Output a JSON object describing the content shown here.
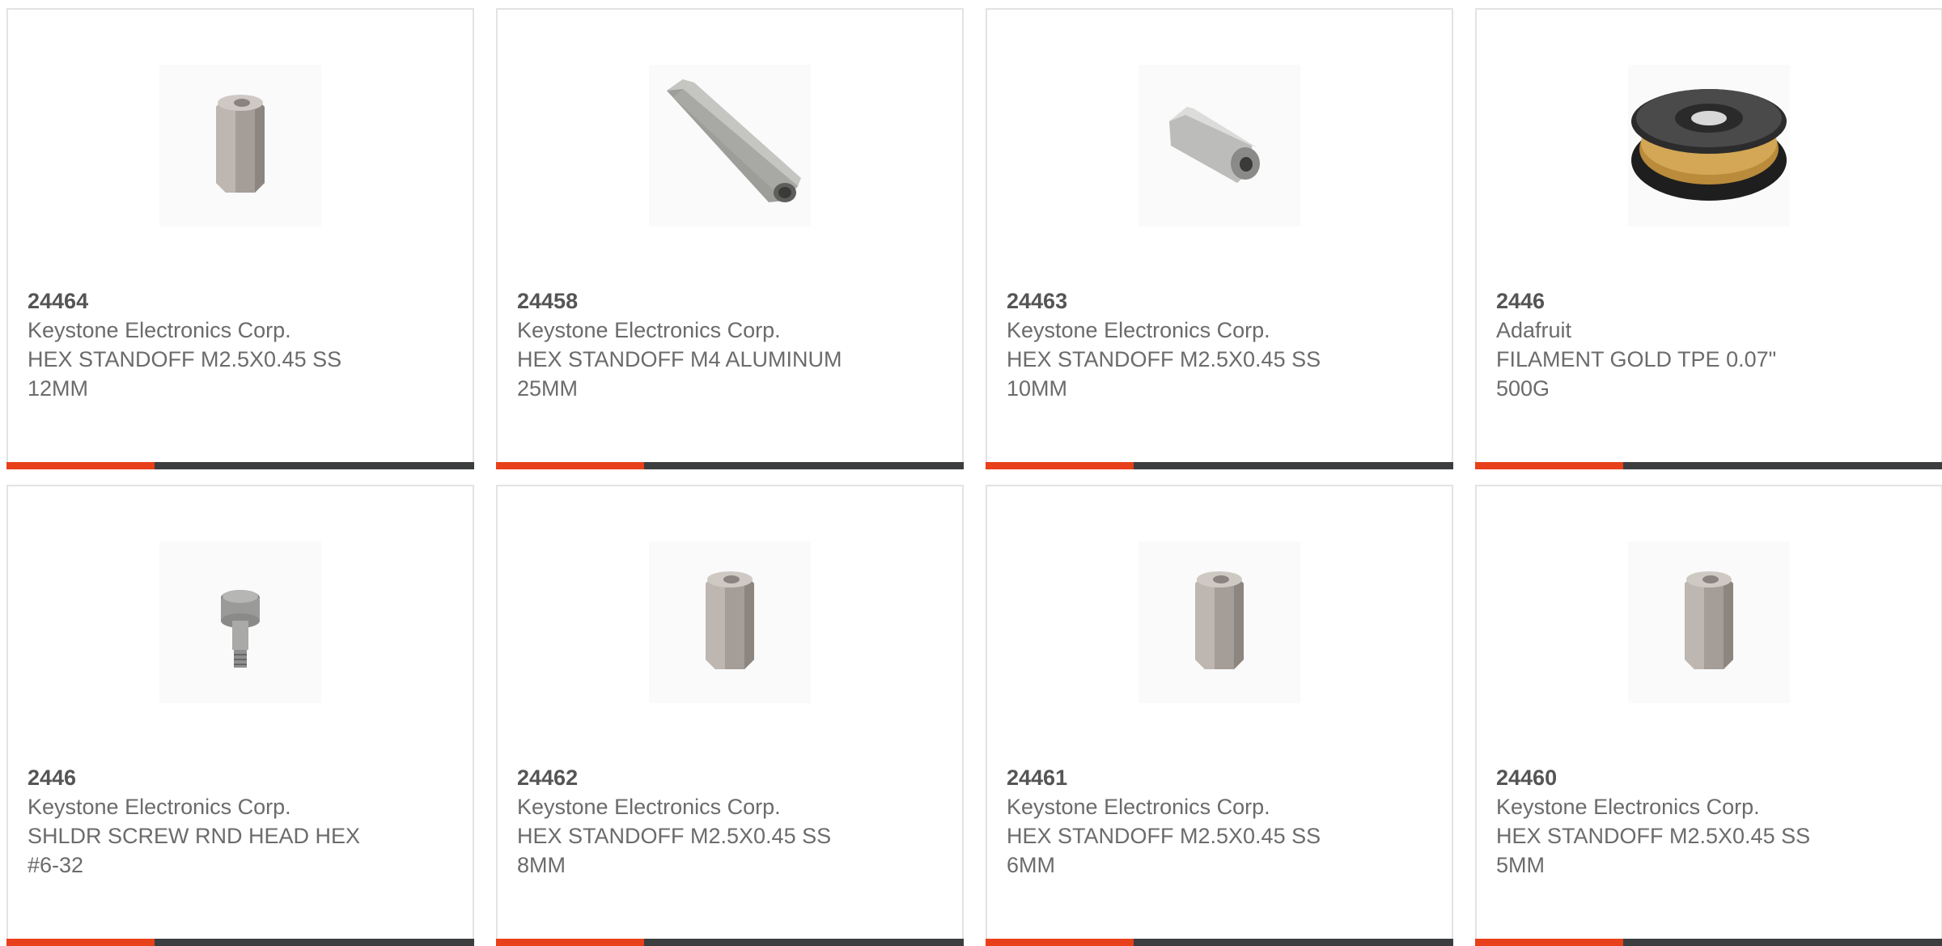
{
  "products": [
    {
      "part_number": "24464",
      "manufacturer": "Keystone Electronics Corp.",
      "desc_line1": "HEX STANDOFF M2.5X0.45 SS",
      "desc_line2": "12MM",
      "image_icon": "hex-standoff-short-icon"
    },
    {
      "part_number": "24458",
      "manufacturer": "Keystone Electronics Corp.",
      "desc_line1": "HEX STANDOFF M4 ALUMINUM",
      "desc_line2": "25MM",
      "image_icon": "hex-standoff-long-icon"
    },
    {
      "part_number": "24463",
      "manufacturer": "Keystone Electronics Corp.",
      "desc_line1": "HEX STANDOFF M2.5X0.45 SS",
      "desc_line2": "10MM",
      "image_icon": "hex-standoff-angled-icon"
    },
    {
      "part_number": "2446",
      "manufacturer": "Adafruit",
      "desc_line1": "FILAMENT GOLD TPE 0.07\"",
      "desc_line2": "500G",
      "image_icon": "filament-spool-icon"
    },
    {
      "part_number": "2446",
      "manufacturer": "Keystone Electronics Corp.",
      "desc_line1": "SHLDR SCREW RND HEAD HEX",
      "desc_line2": "#6-32",
      "image_icon": "shoulder-screw-icon"
    },
    {
      "part_number": "24462",
      "manufacturer": "Keystone Electronics Corp.",
      "desc_line1": "HEX STANDOFF M2.5X0.45 SS",
      "desc_line2": "8MM",
      "image_icon": "hex-standoff-short-icon"
    },
    {
      "part_number": "24461",
      "manufacturer": "Keystone Electronics Corp.",
      "desc_line1": "HEX STANDOFF M2.5X0.45 SS",
      "desc_line2": "6MM",
      "image_icon": "hex-standoff-short-icon"
    },
    {
      "part_number": "24460",
      "manufacturer": "Keystone Electronics Corp.",
      "desc_line1": "HEX STANDOFF M2.5X0.45 SS",
      "desc_line2": "5MM",
      "image_icon": "hex-standoff-short-icon"
    }
  ],
  "colors": {
    "accent": "#e8401a",
    "bar": "#3c3d3f",
    "border": "#e3e3e3",
    "text": "#6b6b6b"
  }
}
